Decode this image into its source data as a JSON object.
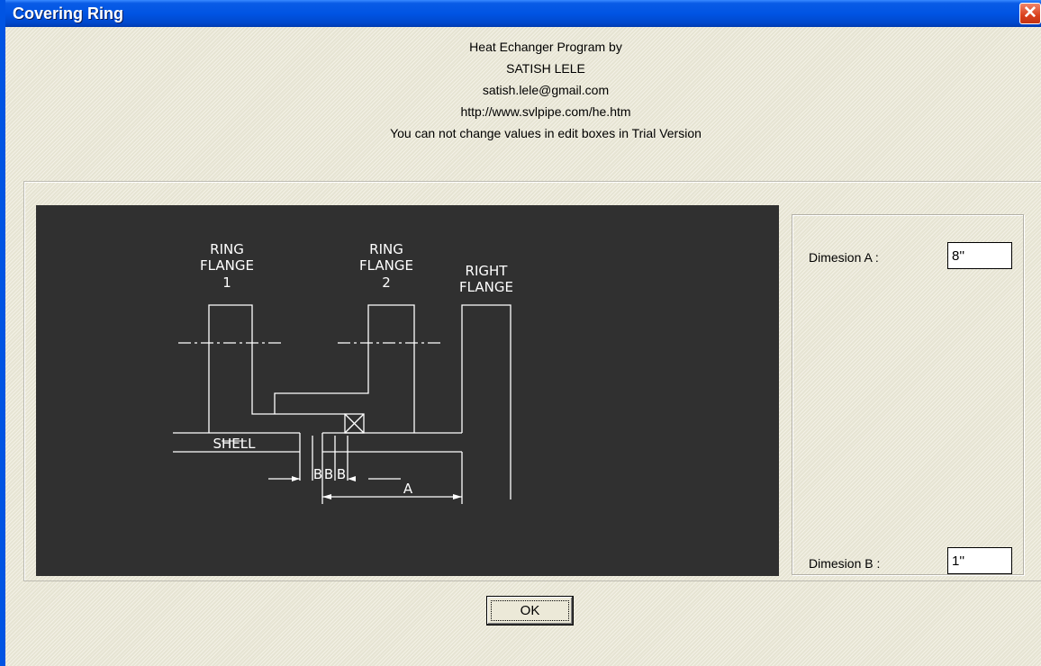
{
  "window": {
    "title": "Covering Ring",
    "close_icon": "close-icon"
  },
  "header": {
    "line1": "Heat Echanger Program by",
    "line2": "SATISH LELE",
    "line3": "satish.lele@gmail.com",
    "line4": "http://www.svlpipe.com/he.htm",
    "line5": "You can not change values in edit boxes in Trial Version"
  },
  "drawing": {
    "label_ring1": [
      "RING",
      "FLANGE",
      "1"
    ],
    "label_ring2": [
      "RING",
      "FLANGE",
      "2"
    ],
    "label_right": [
      "RIGHT",
      "FLANGE"
    ],
    "label_shell": "SHELL",
    "label_b": "B",
    "label_a": "A"
  },
  "dimensions": {
    "a_label": "Dimesion A :",
    "a_value": "8''",
    "b_label": "Dimesion B :",
    "b_value": "1''"
  },
  "buttons": {
    "ok": "OK"
  }
}
